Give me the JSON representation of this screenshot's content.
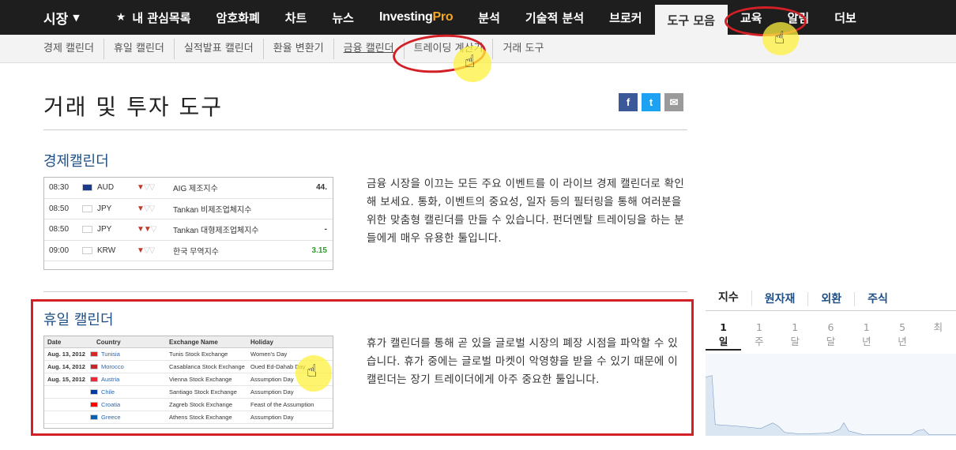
{
  "topnav": {
    "markets": "시장",
    "items": [
      "내 관심목록",
      "암호화폐",
      "차트",
      "뉴스"
    ],
    "brand_a": "Investing",
    "brand_b": "Pro",
    "items2": [
      "분석",
      "기술적 분석",
      "브로커",
      "도구 모음",
      "교육",
      "알림",
      "더보"
    ]
  },
  "subnav": {
    "items": [
      "경제 캘린더",
      "휴일 캘린더",
      "실적발표 캘린더",
      "환율 변환기",
      "금융 캘린더",
      "트레이딩 계산기",
      "거래 도구"
    ]
  },
  "page": {
    "title": "거래 및 투자 도구",
    "share": {
      "facebook": "f",
      "twitter": "t",
      "email": "✉"
    }
  },
  "econ": {
    "title": "경제캘린더",
    "desc": "금융 시장을 이끄는 모든 주요 이벤트를 이 라이브 경제 캘린더로 확인해 보세요. 통화, 이벤트의 중요성, 일자 등의 필터링을 통해 여러분을 위한 맞춤형 캘린더를 만들 수 있습니다. 펀더멘탈 트레이딩을 하는 분들에게 매우 유용한 툴입니다.",
    "rows": [
      {
        "time": "08:30",
        "cur": "AUD",
        "bulls": 1,
        "event": "AIG 제조지수",
        "val": "44.",
        "flag": "#1a3a8a"
      },
      {
        "time": "08:50",
        "cur": "JPY",
        "bulls": 1,
        "event": "Tankan 비제조업체지수",
        "val": "",
        "flag": "#ffffff"
      },
      {
        "time": "08:50",
        "cur": "JPY",
        "bulls": 2,
        "event": "Tankan 대형제조업체지수",
        "val": "-",
        "flag": "#ffffff"
      },
      {
        "time": "09:00",
        "cur": "KRW",
        "bulls": 1,
        "event": "한국 무역지수",
        "val": "3.15",
        "flag": "#ffffff"
      }
    ]
  },
  "holiday": {
    "title": "휴일 캘린더",
    "desc": "휴가 캘린더를 통해 곧 있을 글로벌 시장의 폐장 시점을 파악할 수 있습니다. 휴가 중에는 글로벌 마켓이 악영향을 받을 수 있기 때문에 이 캘린더는 장기 트레이더에게 아주 중요한 툴입니다.",
    "headers": [
      "Date",
      "Country",
      "Exchange Name",
      "Holiday"
    ],
    "rows": [
      {
        "date": "Aug. 13, 2012",
        "country": "Tunisia",
        "exchange": "Tunis Stock Exchange",
        "holiday": "Women's Day",
        "flag": "#d62828"
      },
      {
        "date": "Aug. 14, 2012",
        "country": "Morocco",
        "exchange": "Casablanca Stock Exchange",
        "holiday": "Oued Ed-Dahab Day",
        "flag": "#c1272d"
      },
      {
        "date": "Aug. 15, 2012",
        "country": "Austria",
        "exchange": "Vienna Stock Exchange",
        "holiday": "Assumption Day",
        "flag": "#ed2939"
      },
      {
        "date": "",
        "country": "Chile",
        "exchange": "Santiago Stock Exchange",
        "holiday": "Assumption Day",
        "flag": "#0039a6"
      },
      {
        "date": "",
        "country": "Croatia",
        "exchange": "Zagreb Stock Exchange",
        "holiday": "Feast of the Assumption",
        "flag": "#ff0000"
      },
      {
        "date": "",
        "country": "Greece",
        "exchange": "Athens Stock Exchange",
        "holiday": "Assumption Day",
        "flag": "#0d5eaf"
      }
    ]
  },
  "markets": {
    "tabs": [
      "지수",
      "원자재",
      "외환",
      "주식"
    ],
    "periods": [
      [
        "1",
        "일"
      ],
      [
        "1",
        "주"
      ],
      [
        "1",
        "달"
      ],
      [
        "6",
        "달"
      ],
      [
        "1",
        "년"
      ],
      [
        "5",
        "년"
      ],
      [
        "최",
        ""
      ]
    ]
  },
  "colors": {
    "nav_bg": "#1e1e1e",
    "accent_red": "#d32027",
    "link_blue": "#1e4f85",
    "highlight": "#fff03c"
  }
}
